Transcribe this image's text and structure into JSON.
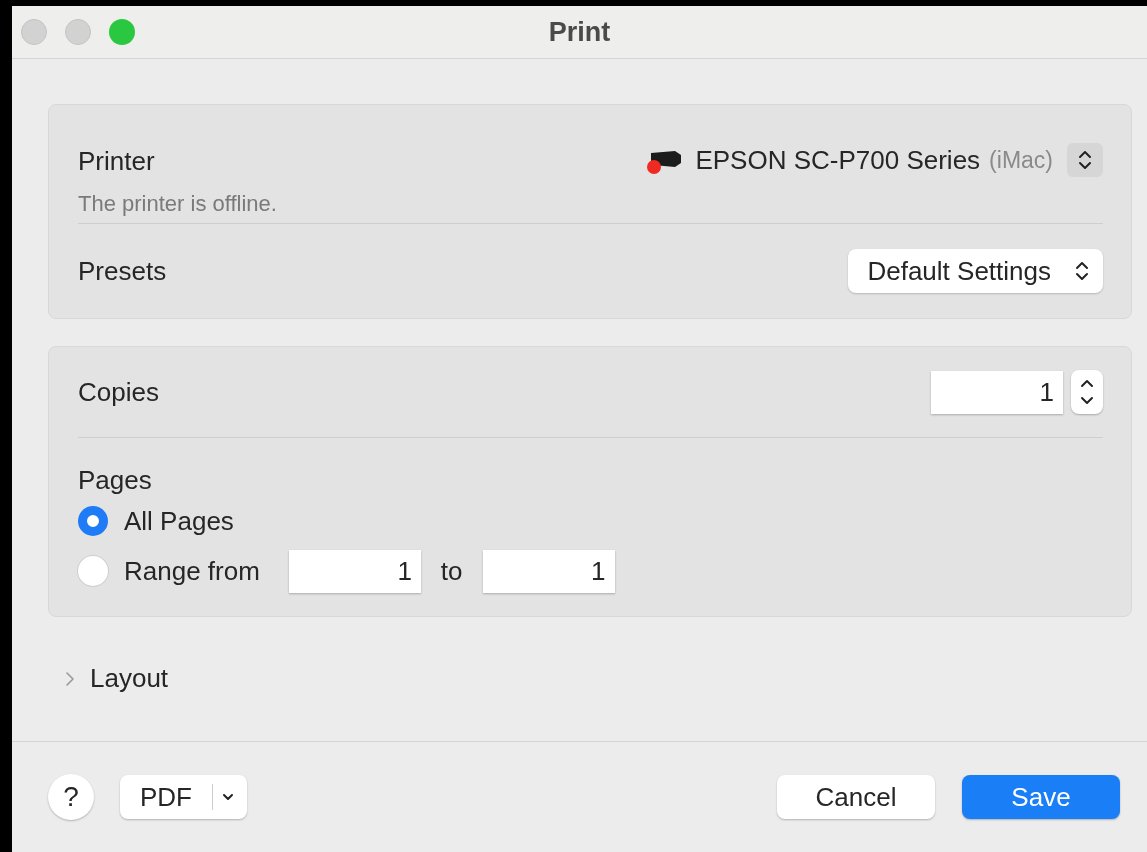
{
  "window": {
    "title": "Print"
  },
  "printer": {
    "label": "Printer",
    "name": "EPSON SC-P700 Series",
    "host": "(iMac)",
    "status": "The printer is offline.",
    "offline": true
  },
  "presets": {
    "label": "Presets",
    "value": "Default Settings"
  },
  "copies": {
    "label": "Copies",
    "value": "1"
  },
  "pages": {
    "label": "Pages",
    "options": [
      {
        "label": "All Pages",
        "selected": true
      },
      {
        "label": "Range from",
        "selected": false
      }
    ],
    "range_from": "1",
    "range_to_label": "to",
    "range_to": "1"
  },
  "layout": {
    "label": "Layout",
    "expanded": false
  },
  "footer": {
    "help": "?",
    "pdf": "PDF",
    "cancel": "Cancel",
    "save": "Save"
  }
}
